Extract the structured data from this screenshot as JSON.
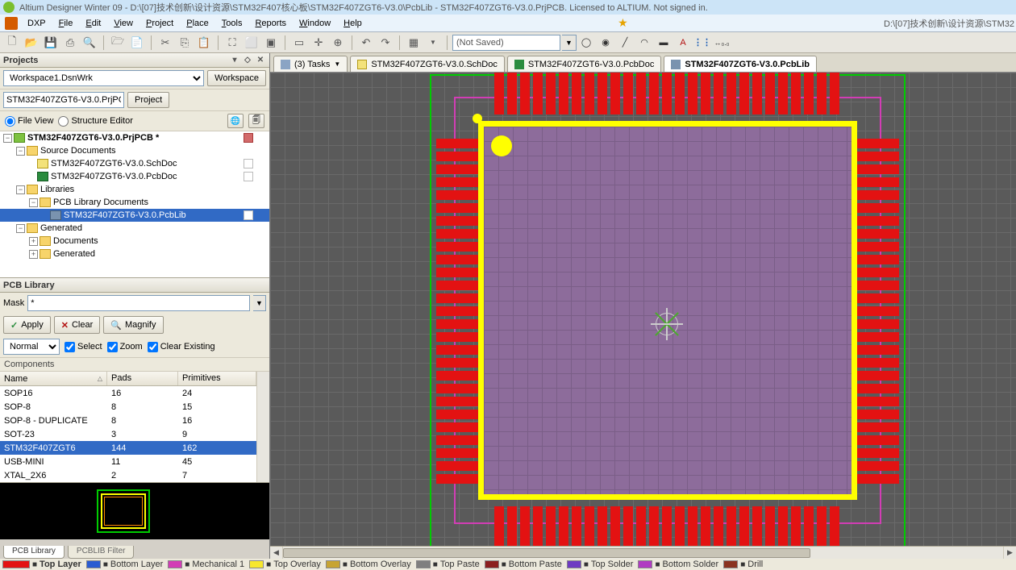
{
  "title": "Altium Designer Winter 09 - D:\\[07]技术创新\\设计资源\\STM32F407核心板\\STM32F407ZGT6-V3.0\\PcbLib - STM32F407ZGT6-V3.0.PrjPCB. Licensed to ALTIUM. Not signed in.",
  "right_path": "D:\\[07]技术创新\\设计资源\\STM32",
  "menu": {
    "dxp": "DXP",
    "file": "File",
    "edit": "Edit",
    "view": "View",
    "project": "Project",
    "place": "Place",
    "tools": "Tools",
    "reports": "Reports",
    "window": "Window",
    "help": "Help"
  },
  "not_saved": "(Not Saved)",
  "projects": {
    "panel_title": "Projects",
    "workspace_sel": "Workspace1.DsnWrk",
    "workspace_btn": "Workspace",
    "project_txt": "STM32F407ZGT6-V3.0.PrjPCB",
    "project_btn": "Project",
    "file_view": "File View",
    "struct_editor": "Structure Editor"
  },
  "tree": {
    "prj": "STM32F407ZGT6-V3.0.PrjPCB *",
    "src": "Source Documents",
    "sch": "STM32F407ZGT6-V3.0.SchDoc",
    "pcb": "STM32F407ZGT6-V3.0.PcbDoc",
    "libs": "Libraries",
    "pcblibdocs": "PCB Library Documents",
    "pcblib": "STM32F407ZGT6-V3.0.PcbLib",
    "gen": "Generated",
    "docs": "Documents",
    "gen2": "Generated"
  },
  "pcblib": {
    "panel_title": "PCB Library",
    "mask_lbl": "Mask",
    "mask_val": "*",
    "apply": "Apply",
    "clear": "Clear",
    "magnify": "Magnify",
    "normal": "Normal",
    "select": "Select",
    "zoom": "Zoom",
    "clearex": "Clear Existing",
    "components": "Components",
    "col_name": "Name",
    "col_pads": "Pads",
    "col_prim": "Primitives"
  },
  "components": [
    {
      "name": "SOP16",
      "pads": "16",
      "prim": "24"
    },
    {
      "name": "SOP-8",
      "pads": "8",
      "prim": "15"
    },
    {
      "name": "SOP-8 - DUPLICATE",
      "pads": "8",
      "prim": "16"
    },
    {
      "name": "SOT-23",
      "pads": "3",
      "prim": "9"
    },
    {
      "name": "STM32F407ZGT6",
      "pads": "144",
      "prim": "162"
    },
    {
      "name": "USB-MINI",
      "pads": "11",
      "prim": "45"
    },
    {
      "name": "XTAL_2X6",
      "pads": "2",
      "prim": "7"
    }
  ],
  "bottom_tabs": {
    "pcblib": "PCB Library",
    "filter": "PCBLIB Filter"
  },
  "doc_tabs": {
    "tasks": "(3) Tasks",
    "sch": "STM32F407ZGT6-V3.0.SchDoc",
    "pcb": "STM32F407ZGT6-V3.0.PcbDoc",
    "lib": "STM32F407ZGT6-V3.0.PcbLib"
  },
  "layers": {
    "top": "Top Layer",
    "bot": "Bottom Layer",
    "mech": "Mechanical 1",
    "tov": "Top Overlay",
    "bov": "Bottom Overlay",
    "tp": "Top Paste",
    "bp": "Bottom Paste",
    "ts": "Top Solder",
    "bs": "Bottom Solder",
    "drl": "Drill"
  },
  "colors": {
    "top": "#e31212",
    "bot": "#2a5bd1",
    "mech": "#d23db5",
    "tov": "#f7e72e",
    "bov": "#c7a433",
    "tp": "#7f7f7f",
    "bp": "#8b1f1f",
    "ts": "#6e3bc2",
    "bs": "#b03bc2",
    "drl": "#8a3320"
  }
}
